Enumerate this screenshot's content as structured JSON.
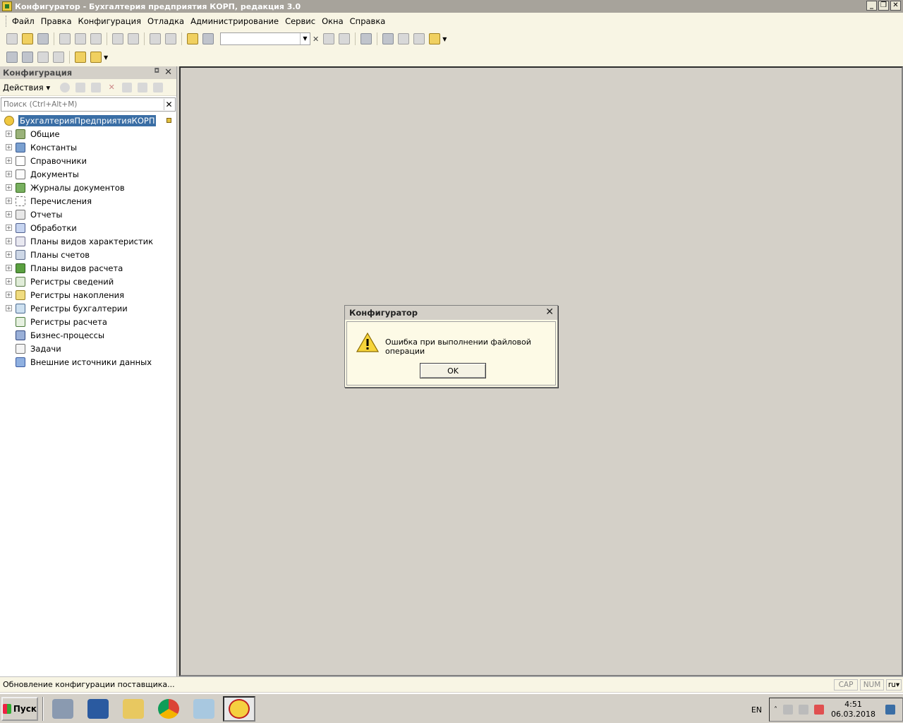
{
  "window": {
    "title": "Конфигуратор - Бухгалтерия предприятия КОРП, редакция 3.0"
  },
  "menu": [
    "Файл",
    "Правка",
    "Конфигурация",
    "Отладка",
    "Администрирование",
    "Сервис",
    "Окна",
    "Справка"
  ],
  "panel": {
    "title": "Конфигурация",
    "actions_label": "Действия",
    "search_placeholder": "Поиск (Ctrl+Alt+M)",
    "root": "БухгалтерияПредприятияКОРП",
    "items": [
      {
        "label": "Общие",
        "icon": "common-icon"
      },
      {
        "label": "Константы",
        "icon": "constants-icon"
      },
      {
        "label": "Справочники",
        "icon": "catalogs-icon"
      },
      {
        "label": "Документы",
        "icon": "documents-icon"
      },
      {
        "label": "Журналы документов",
        "icon": "journals-icon"
      },
      {
        "label": "Перечисления",
        "icon": "enums-icon"
      },
      {
        "label": "Отчеты",
        "icon": "reports-icon"
      },
      {
        "label": "Обработки",
        "icon": "processing-icon"
      },
      {
        "label": "Планы видов характеристик",
        "icon": "char-plans-icon"
      },
      {
        "label": "Планы счетов",
        "icon": "accounts-plans-icon"
      },
      {
        "label": "Планы видов расчета",
        "icon": "calc-plans-icon"
      },
      {
        "label": "Регистры сведений",
        "icon": "info-registers-icon"
      },
      {
        "label": "Регистры накопления",
        "icon": "accum-registers-icon"
      },
      {
        "label": "Регистры бухгалтерии",
        "icon": "account-registers-icon"
      },
      {
        "label": "Регистры расчета",
        "icon": "calc-registers-icon"
      },
      {
        "label": "Бизнес-процессы",
        "icon": "business-process-icon"
      },
      {
        "label": "Задачи",
        "icon": "tasks-icon"
      },
      {
        "label": "Внешние источники данных",
        "icon": "external-sources-icon"
      }
    ]
  },
  "dialog": {
    "title": "Конфигуратор",
    "message": "Ошибка при выполнении файловой операции",
    "ok": "OK"
  },
  "status": {
    "text": "Обновление конфигурации поставщика...",
    "cap": "CAP",
    "num": "NUM",
    "lang": "ru"
  },
  "taskbar": {
    "start": "Пуск",
    "lang": "EN",
    "time": "4:51",
    "date": "06.03.2018"
  }
}
